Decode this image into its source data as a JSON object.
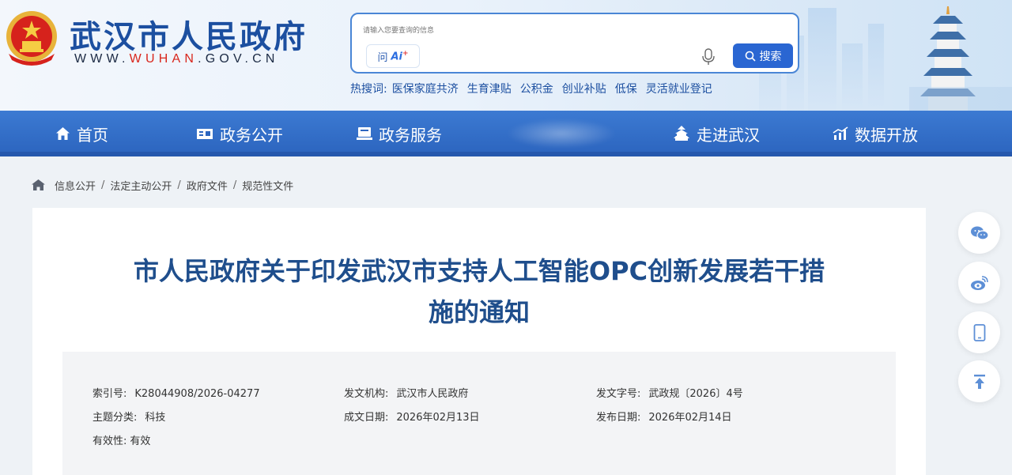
{
  "header": {
    "site_title": "武汉市人民政府",
    "url_prefix": "WWW.",
    "url_highlight": "WUHAN",
    "url_suffix": ".GOV.CN"
  },
  "search": {
    "placeholder": "请输入您要查询的信息",
    "ai_chip_text": "问",
    "ai_chip_brand": "Ai",
    "ai_chip_mark": "+",
    "button_label": "搜索"
  },
  "hot_words": {
    "label": "热搜词:",
    "items": [
      "医保家庭共济",
      "生育津贴",
      "公积金",
      "创业补贴",
      "低保",
      "灵活就业登记"
    ]
  },
  "nav": {
    "items": [
      {
        "label": "首页",
        "icon": "home-icon"
      },
      {
        "label": "政务公开",
        "icon": "open-affairs-icon"
      },
      {
        "label": "政务服务",
        "icon": "service-icon"
      },
      {
        "label": "走进武汉",
        "icon": "pavilion-icon"
      },
      {
        "label": "数据开放",
        "icon": "chart-icon"
      }
    ]
  },
  "breadcrumb": {
    "items": [
      "信息公开",
      "法定主动公开",
      "政府文件",
      "规范性文件"
    ],
    "separator": "/"
  },
  "document": {
    "title_line1": "市人民政府关于印发武汉市支持人工智能OPC创新发展若干措",
    "title_line2": "施的通知",
    "meta": {
      "index_key": "索引号:",
      "index_val": "K28044908/2026-04277",
      "issuer_key": "发文机构:",
      "issuer_val": "武汉市人民政府",
      "docno_key": "发文字号:",
      "docno_val": "武政规〔2026〕4号",
      "topic_key": "主题分类:",
      "topic_val": "科技",
      "written_key": "成文日期:",
      "written_val": "2026年02月13日",
      "published_key": "发布日期:",
      "published_val": "2026年02月14日",
      "validity_key": "有效性:",
      "validity_val": "有效"
    }
  },
  "side_tools": [
    "wechat-icon",
    "weibo-icon",
    "mobile-icon",
    "back-to-top-icon"
  ],
  "colors": {
    "brand_blue": "#1c4fa0",
    "nav_blue": "#2d66c0",
    "url_red": "#d9261c",
    "title_blue": "#1f4e8c",
    "search_button": "#2a66d2"
  }
}
